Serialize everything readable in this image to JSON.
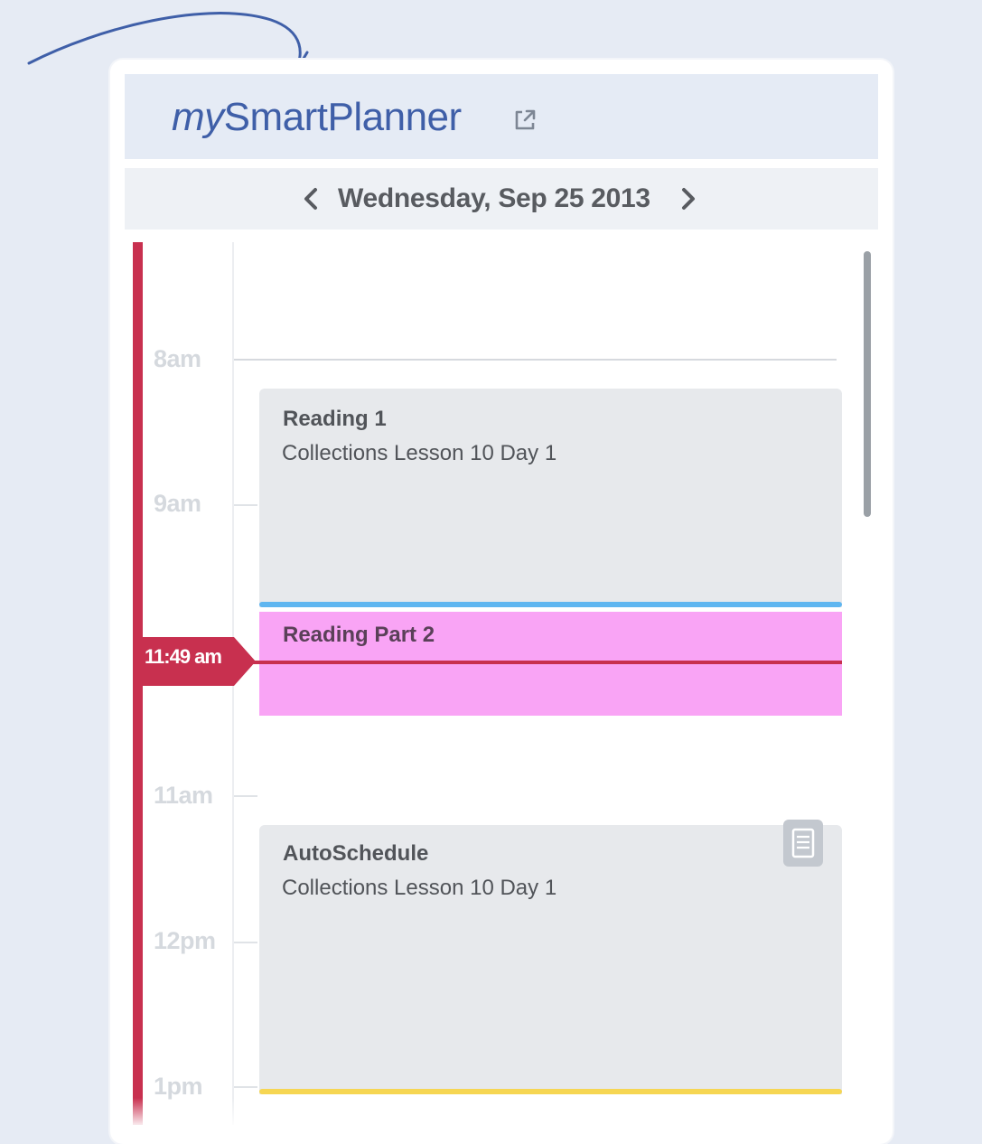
{
  "app": {
    "title_prefix": "my",
    "title_main": "SmartPlanner"
  },
  "date_nav": {
    "current_date": "Wednesday, Sep 25 2013"
  },
  "timeline": {
    "hours": [
      "8am",
      "9am",
      "11am",
      "12pm",
      "1pm"
    ],
    "now_label": "11:49 am"
  },
  "events": [
    {
      "title": "Reading 1",
      "subtitle": "Collections Lesson 10 Day 1",
      "accent_color": "#5fb6f0"
    },
    {
      "title": "Reading Part 2",
      "color": "#f9a4f5"
    },
    {
      "title": "AutoSchedule",
      "subtitle": "Collections Lesson 10 Day 1",
      "accent_color": "#f6d653"
    }
  ],
  "icons": {
    "brand_link": "external-link-icon",
    "prev": "chevron-left-icon",
    "next": "chevron-right-icon",
    "note": "notepad-icon"
  },
  "colors": {
    "brand": "#3f5fa8",
    "timeline": "#c8304f",
    "header_bg": "#e5ebf5"
  }
}
